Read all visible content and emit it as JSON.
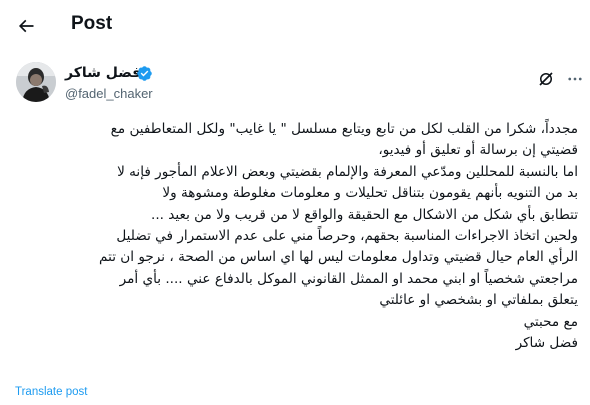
{
  "header": {
    "title": "Post",
    "back_icon": "arrow-left-icon"
  },
  "author": {
    "name": "فضل شاكر",
    "handle": "@fadel_chaker",
    "verified_color": "#1d9bf0"
  },
  "post": {
    "lines": [
      "مجدداً، شكرا من القلب لكل من تابع ويتابع مسلسل \" يا غايب\" ولكل المتعاطفين مع",
      "قضيتي إن برسالة أو تعليق أو فيديو،",
      "اما بالنسبة للمحللين ومدّعي المعرفة والإلمام بقضيتي وبعض الاعلام المأجور فإنه لا",
      "بد من التنويه بأنهم يقومون  بتناقل تحليلات و معلومات مغلوطة ومشوهة ولا",
      "تتطابق بأي شكل من الاشكال مع الحقيقة والواقع لا من قريب ولا من بعيد ...",
      "ولحين اتخاذ الاجراءات المناسبة بحقهم، وحرصاً مني على عدم الاستمرار في تضليل",
      "الرأي العام حيال قضيتي وتداول معلومات ليس لها اي اساس من الصحة ، نرجو ان تتم",
      "مراجعتي شخصياً او ابني محمد او الممثل القانوني الموكل بالدفاع عني ....  بأي أمر",
      "يتعلق بملفاتي او بشخصي او عائلتي",
      "مع محبتي",
      "فضل شاكر"
    ]
  },
  "translate_label": "Translate post"
}
